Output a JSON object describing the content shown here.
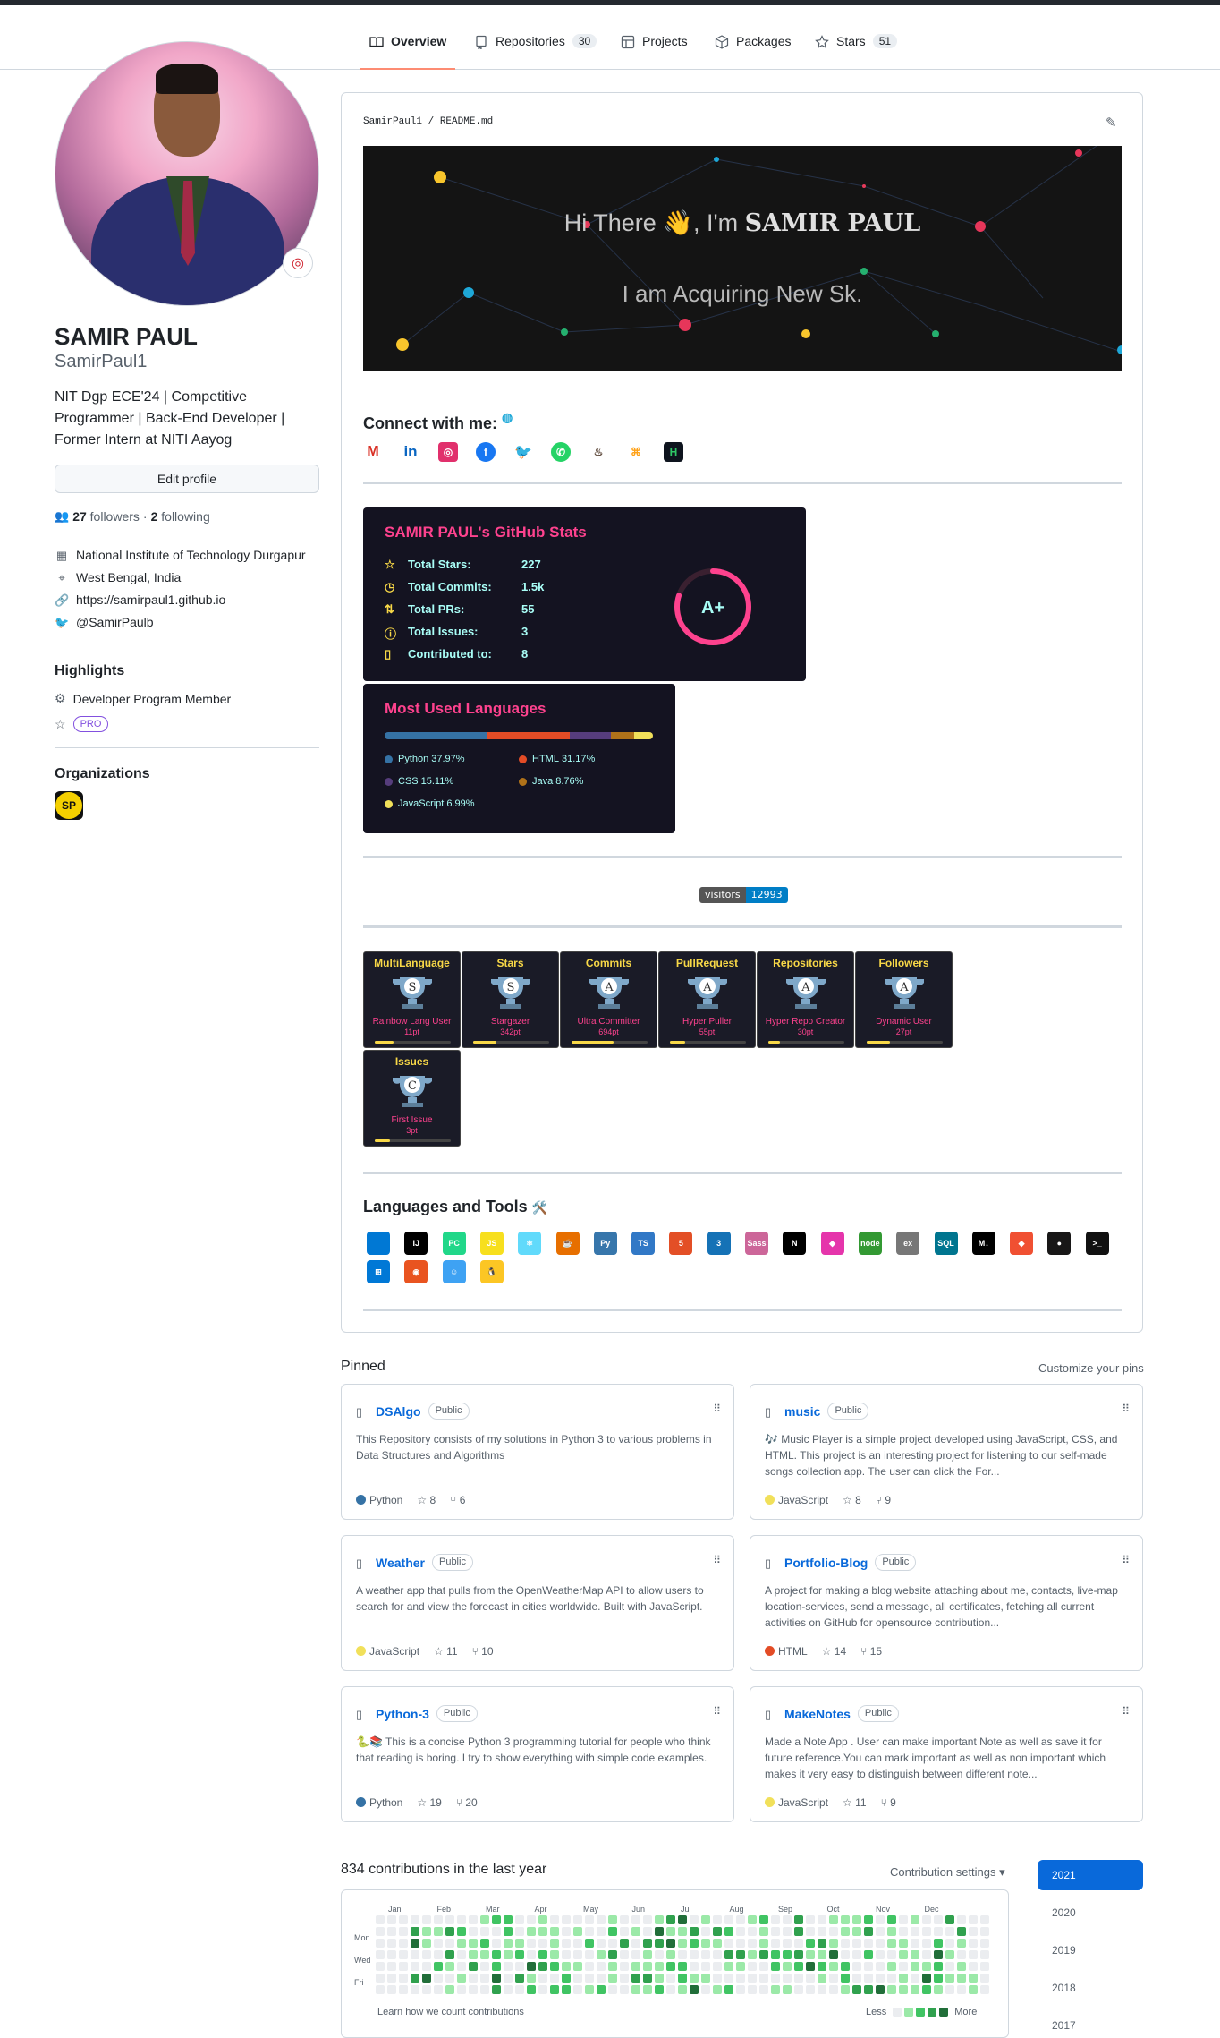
{
  "tabs": [
    {
      "label": "Overview",
      "count": ""
    },
    {
      "label": "Repositories",
      "count": "30"
    },
    {
      "label": "Projects",
      "count": ""
    },
    {
      "label": "Packages",
      "count": ""
    },
    {
      "label": "Stars",
      "count": "51"
    }
  ],
  "profile": {
    "name": "SAMIR PAUL",
    "login": "SamirPaul1",
    "bio": "NIT Dgp ECE'24 | Competitive Programmer | Back-End Developer | Former Intern at NITI Aayog",
    "edit_label": "Edit profile",
    "followers_count": "27",
    "followers_label": "followers",
    "following_count": "2",
    "following_label": "following",
    "separator": "·",
    "org": "National Institute of Technology Durgapur",
    "location": "West Bengal, India",
    "website": "https://samirpaul1.github.io",
    "twitter": "@SamirPaulb"
  },
  "highlights": {
    "title": "Highlights",
    "item": "Developer Program Member",
    "pro": "PRO"
  },
  "organizations": {
    "title": "Organizations",
    "logo_text": "SP"
  },
  "readme": {
    "path": "SamirPaul1 / README.md",
    "banner_line1": "Hi There",
    "banner_wave": "👋",
    "banner_im": ", I'm",
    "banner_name": "SAMIR PAUL",
    "banner_line2": "I am Acquiring New Sk.",
    "connect_title": "Connect with me:",
    "social_icons": [
      "gmail-icon",
      "linkedin-icon",
      "instagram-icon",
      "facebook-icon",
      "twitter-icon",
      "whatsapp-icon",
      "codechef-icon",
      "leetcode-icon",
      "hackerrank-icon"
    ],
    "visitors_label": "visitors",
    "visitors_count": "12993",
    "tools_title": "Languages and Tools",
    "tools_emoji": "🛠️"
  },
  "stats_card": {
    "title": "SAMIR PAUL's GitHub Stats",
    "rows": [
      {
        "label": "Total Stars:",
        "value": "227"
      },
      {
        "label": "Total Commits:",
        "value": "1.5k"
      },
      {
        "label": "Total PRs:",
        "value": "55"
      },
      {
        "label": "Total Issues:",
        "value": "3"
      },
      {
        "label": "Contributed to:",
        "value": "8"
      }
    ],
    "grade": "A+",
    "grade_fraction": 0.8,
    "colors": {
      "bg": "#141321",
      "title": "#fe428e",
      "text": "#a9fef7",
      "icon": "#f8d847"
    }
  },
  "langs_card": {
    "title": "Most Used Languages",
    "items": [
      {
        "name": "Python",
        "pct": "37.97%",
        "share": 37.97,
        "color": "#3572A5"
      },
      {
        "name": "HTML",
        "pct": "31.17%",
        "share": 31.17,
        "color": "#e34c26"
      },
      {
        "name": "CSS",
        "pct": "15.11%",
        "share": 15.11,
        "color": "#563d7c"
      },
      {
        "name": "Java",
        "pct": "8.76%",
        "share": 8.76,
        "color": "#b07219"
      },
      {
        "name": "JavaScript",
        "pct": "6.99%",
        "share": 6.99,
        "color": "#f1e05a"
      }
    ]
  },
  "trophies": [
    {
      "title": "MultiLanguage",
      "rank": "S",
      "sub": "Rainbow Lang User",
      "pts": "11pt",
      "progress": 0.25
    },
    {
      "title": "Stars",
      "rank": "S",
      "sub": "Stargazer",
      "pts": "342pt",
      "progress": 0.3
    },
    {
      "title": "Commits",
      "rank": "A",
      "sub": "Ultra Committer",
      "pts": "694pt",
      "progress": 0.55
    },
    {
      "title": "PullRequest",
      "rank": "A",
      "sub": "Hyper Puller",
      "pts": "55pt",
      "progress": 0.2
    },
    {
      "title": "Repositories",
      "rank": "A",
      "sub": "Hyper Repo Creator",
      "pts": "30pt",
      "progress": 0.15
    },
    {
      "title": "Followers",
      "rank": "A",
      "sub": "Dynamic User",
      "pts": "27pt",
      "progress": 0.3
    },
    {
      "title": "Issues",
      "rank": "C",
      "sub": "First Issue",
      "pts": "3pt",
      "progress": 0.2
    }
  ],
  "tools": [
    {
      "icon": "vscode-icon",
      "text": "",
      "color": "#0078d4"
    },
    {
      "icon": "intellij-icon",
      "text": "IJ",
      "color": "#000000"
    },
    {
      "icon": "pycharm-icon",
      "text": "PC",
      "color": "#21d789"
    },
    {
      "icon": "javascript-icon",
      "text": "JS",
      "color": "#f7df1e"
    },
    {
      "icon": "react-icon",
      "text": "⚛",
      "color": "#61dafb"
    },
    {
      "icon": "java-icon",
      "text": "☕",
      "color": "#e76f00"
    },
    {
      "icon": "python-icon",
      "text": "Py",
      "color": "#3776ab"
    },
    {
      "icon": "typescript-icon",
      "text": "TS",
      "color": "#3178c6"
    },
    {
      "icon": "html5-icon",
      "text": "5",
      "color": "#e34f26"
    },
    {
      "icon": "css3-icon",
      "text": "3",
      "color": "#1572b6"
    },
    {
      "icon": "sass-icon",
      "text": "Sass",
      "color": "#cc6699"
    },
    {
      "icon": "nextjs-icon",
      "text": "N",
      "color": "#000000"
    },
    {
      "icon": "graphql-icon",
      "text": "◆",
      "color": "#e535ab"
    },
    {
      "icon": "nodejs-icon",
      "text": "node",
      "color": "#339933"
    },
    {
      "icon": "express-icon",
      "text": "ex",
      "color": "#777777"
    },
    {
      "icon": "mysql-icon",
      "text": "SQL",
      "color": "#00758f"
    },
    {
      "icon": "markdown-icon",
      "text": "M↓",
      "color": "#000000"
    },
    {
      "icon": "git-icon",
      "text": "◆",
      "color": "#f05032"
    },
    {
      "icon": "github-icon",
      "text": "●",
      "color": "#181717"
    },
    {
      "icon": "terminal-icon",
      "text": ">_",
      "color": "#111111"
    },
    {
      "icon": "windows-icon",
      "text": "⊞",
      "color": "#0078d6"
    },
    {
      "icon": "ubuntu-icon",
      "text": "◉",
      "color": "#e95420"
    },
    {
      "icon": "finder-icon",
      "text": "☺",
      "color": "#3ea2f3"
    },
    {
      "icon": "linux-icon",
      "text": "🐧",
      "color": "#fcc624"
    }
  ],
  "pinned": {
    "title": "Pinned",
    "customize": "Customize your pins",
    "public_label": "Public",
    "repos": [
      {
        "name": "DSAlgo",
        "desc": "This Repository consists of my solutions in Python 3 to various problems in Data Structures and Algorithms",
        "lang": "Python",
        "color": "#3572A5",
        "stars": "8",
        "forks": "6"
      },
      {
        "name": "music",
        "desc": "🎶 Music Player is a simple project developed using JavaScript, CSS, and HTML. This project is an interesting project for listening to our self-made songs collection app. The user can click the For...",
        "lang": "JavaScript",
        "color": "#f1e05a",
        "stars": "8",
        "forks": "9"
      },
      {
        "name": "Weather",
        "desc": "A weather app that pulls from the OpenWeatherMap API to allow users to search for and view the forecast in cities worldwide. Built with JavaScript.",
        "lang": "JavaScript",
        "color": "#f1e05a",
        "stars": "11",
        "forks": "10"
      },
      {
        "name": "Portfolio-Blog",
        "desc": "A project for making a blog website attaching about me, contacts, live-map location-services, send a message, all certificates, fetching all current activities on GitHub for opensource contribution...",
        "lang": "HTML",
        "color": "#e34c26",
        "stars": "14",
        "forks": "15"
      },
      {
        "name": "Python-3",
        "desc": "🐍📚 This is a concise Python 3 programming tutorial for people who think that reading is boring. I try to show everything with simple code examples.",
        "lang": "Python",
        "color": "#3572A5",
        "stars": "19",
        "forks": "20"
      },
      {
        "name": "MakeNotes",
        "desc": "Made a Note App . User can make important Note as well as save it for future reference.You can mark important as well as non important which makes it very easy to distinguish between different note...",
        "lang": "JavaScript",
        "color": "#f1e05a",
        "stars": "11",
        "forks": "9"
      }
    ]
  },
  "contributions": {
    "title": "834 contributions in the last year",
    "settings": "Contribution settings ▾",
    "months": [
      "Jan",
      "Feb",
      "Mar",
      "Apr",
      "May",
      "Jun",
      "Jul",
      "Aug",
      "Sep",
      "Oct",
      "Nov",
      "Dec"
    ],
    "days": [
      "Mon",
      "Wed",
      "Fri"
    ],
    "learn": "Learn how we count contributions",
    "less": "Less",
    "more": "More",
    "levels": [
      "#ebedf0",
      "#9be9a8",
      "#40c463",
      "#30a14e",
      "#216e39"
    ],
    "years": [
      "2021",
      "2020",
      "2019",
      "2018",
      "2017"
    ]
  }
}
